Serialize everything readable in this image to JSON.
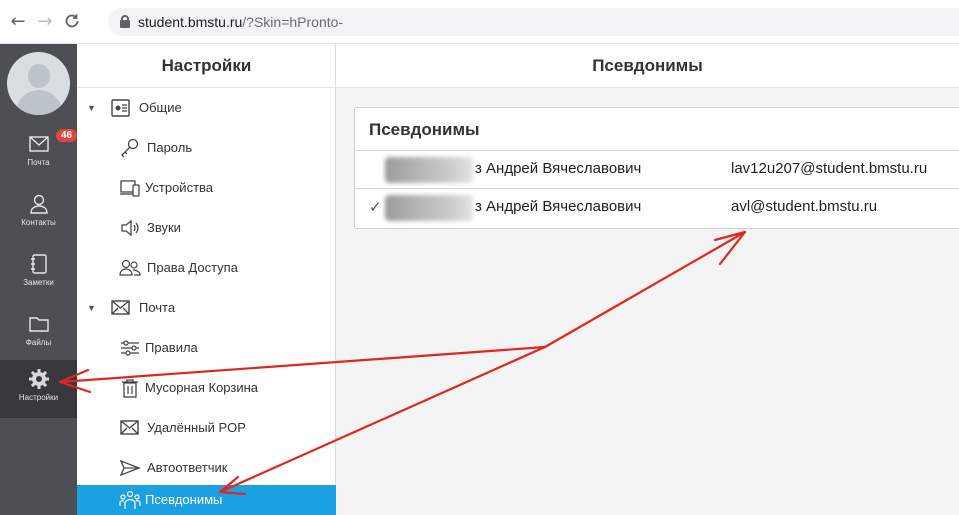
{
  "browser": {
    "back_icon": "back-arrow-icon",
    "forward_icon": "forward-arrow-icon",
    "reload_icon": "reload-icon",
    "url_host": "student.bmstu.ru",
    "url_path": "/?Skin=hPronto-"
  },
  "rail": {
    "items": [
      {
        "label": "Почта",
        "icon": "envelope-icon",
        "badge": "46"
      },
      {
        "label": "Контакты",
        "icon": "person-icon"
      },
      {
        "label": "Заметки",
        "icon": "notebook-icon"
      },
      {
        "label": "Файлы",
        "icon": "folder-icon"
      },
      {
        "label": "Настройки",
        "icon": "gear-icon",
        "active": true
      }
    ]
  },
  "sidebar": {
    "title": "Настройки",
    "items": [
      {
        "label": "Общие",
        "icon": "settings-panel-icon",
        "expandable": true
      },
      {
        "label": "Пароль",
        "icon": "key-icon"
      },
      {
        "label": "Устройства",
        "icon": "devices-icon"
      },
      {
        "label": "Звуки",
        "icon": "speaker-icon"
      },
      {
        "label": "Права Доступа",
        "icon": "people-icon"
      },
      {
        "label": "Почта",
        "icon": "envelope-icon",
        "expandable": true
      },
      {
        "label": "Правила",
        "icon": "sliders-icon"
      },
      {
        "label": "Мусорная Корзина",
        "icon": "trash-icon"
      },
      {
        "label": "Удалённый POP",
        "icon": "envelope-icon"
      },
      {
        "label": "Автоответчик",
        "icon": "plane-icon"
      },
      {
        "label": "Псевдонимы",
        "icon": "group-icon",
        "active": true
      }
    ]
  },
  "main": {
    "title": "Псевдонимы",
    "panel_title": "Псевдонимы",
    "rows": [
      {
        "name": "з Андрей Вячеславович",
        "email": "lav12u207@student.bmstu.ru",
        "checked": false
      },
      {
        "name": "з Андрей Вячеславович",
        "email": "avl@student.bmstu.ru",
        "checked": true
      }
    ],
    "check_mark": "✓"
  },
  "colors": {
    "rail_bg": "#4c4f54",
    "accent": "#1ba1e2",
    "badge": "#e2453b",
    "annotation": "#e0271d"
  }
}
